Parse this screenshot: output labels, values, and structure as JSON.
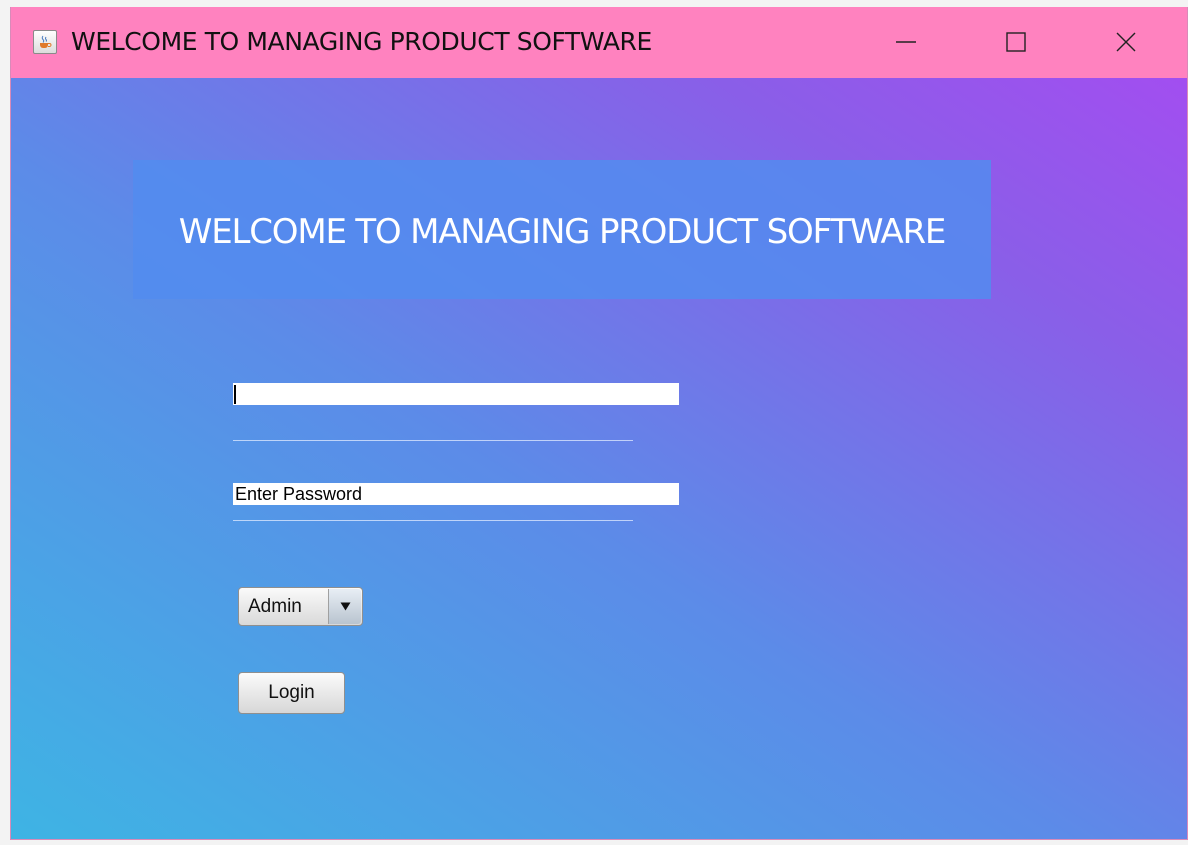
{
  "window": {
    "title": "WELCOME TO MANAGING PRODUCT SOFTWARE",
    "icon": "java-cup-icon",
    "controls": {
      "minimize_icon": "minimize-icon",
      "maximize_icon": "maximize-icon",
      "close_icon": "close-icon"
    },
    "titlebar_color": "#ff82bf"
  },
  "banner": {
    "text": "WELCOME TO MANAGING PRODUCT SOFTWARE",
    "color": "#528cee"
  },
  "form": {
    "username_value": "",
    "password_value": "Enter Password",
    "role_options_selected": "Admin",
    "role_dropdown_icon": "dropdown-arrow-icon",
    "login_label": "Login"
  },
  "colors": {
    "background_start": "#3eb4e4",
    "background_end": "#a24ef0"
  }
}
